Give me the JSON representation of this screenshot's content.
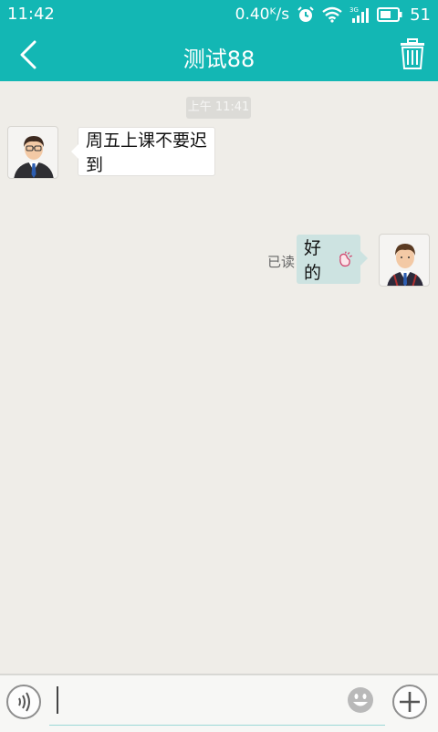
{
  "status_bar": {
    "time": "11:42",
    "net_speed": "0.40ᴷ/s",
    "battery_level": "51",
    "icons": [
      "alarm-icon",
      "wifi-icon",
      "signal-3g-icon",
      "battery-icon"
    ]
  },
  "header": {
    "title": "测试88",
    "back_icon": "chevron-left-icon",
    "delete_icon": "trash-icon"
  },
  "chat": {
    "timestamp": "上午 11:41",
    "messages": [
      {
        "direction": "incoming",
        "text": "周五上课不要迟到"
      },
      {
        "direction": "outgoing",
        "text": "好的",
        "emoji": "ok-hand-emoji",
        "receipt": "已读"
      }
    ]
  },
  "input_bar": {
    "voice_icon": "voice-icon",
    "emoji_icon": "smiley-icon",
    "add_icon": "plus-icon",
    "text_value": ""
  },
  "colors": {
    "accent": "#13b7b4",
    "background": "#efede8",
    "outgoing_bubble": "#cde3e1",
    "incoming_bubble": "#ffffff"
  }
}
